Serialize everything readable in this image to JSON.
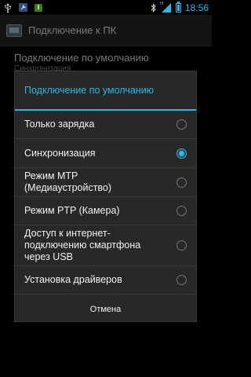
{
  "status_bar": {
    "time": "18:56",
    "network_type": "H",
    "icons": [
      "usb-icon",
      "wrench-icon",
      "info-icon",
      "bluetooth-icon",
      "signal-icon",
      "battery-icon"
    ],
    "accent_color": "#33b5e5"
  },
  "action_bar": {
    "title": "Подключение к ПК"
  },
  "background_preference": {
    "title": "Подключение по умолчанию",
    "summary": "Синхронизация"
  },
  "dialog": {
    "title": "Подключение по умолчанию",
    "options": [
      {
        "label": "Только зарядка",
        "checked": false
      },
      {
        "label": "Синхронизация",
        "checked": true
      },
      {
        "label": "Режим MTP\n(Медиаустройство)",
        "checked": false
      },
      {
        "label": "Режим PTP (Камера)",
        "checked": false
      },
      {
        "label": "Доступ к интернет-\nподключению смартфона\nчерез USB",
        "checked": false
      },
      {
        "label": "Установка драйверов",
        "checked": false
      }
    ],
    "cancel_label": "Отмена"
  }
}
